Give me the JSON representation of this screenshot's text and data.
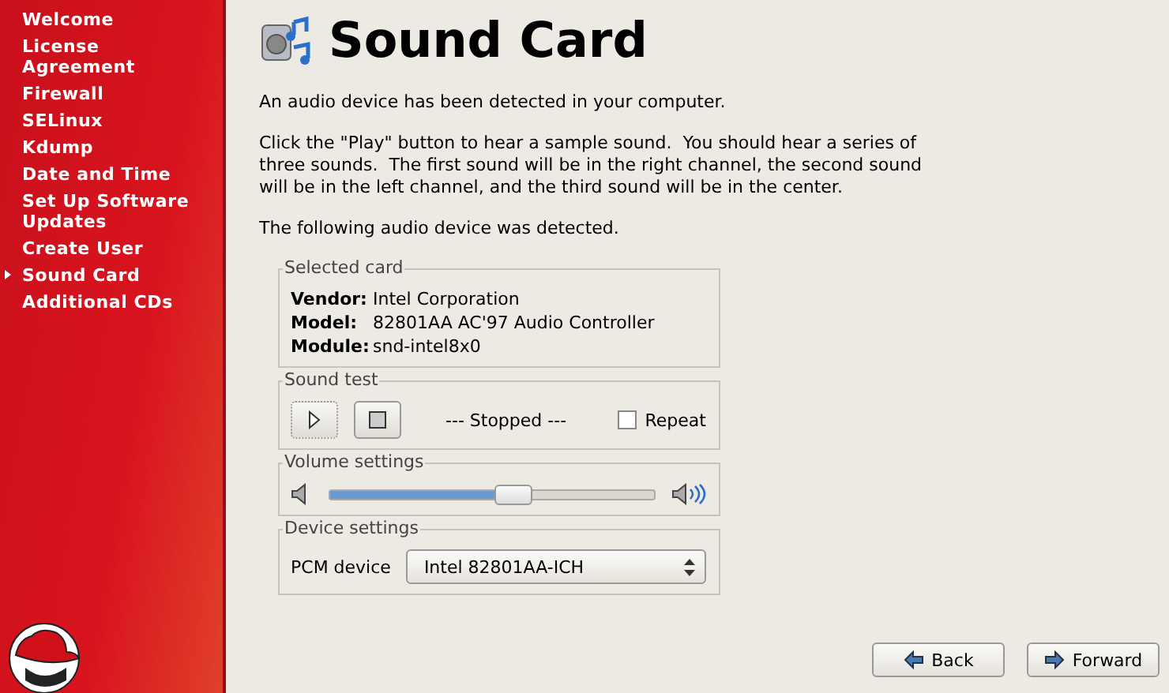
{
  "sidebar": {
    "items": [
      {
        "label": "Welcome",
        "selected": false
      },
      {
        "label": "License Agreement",
        "selected": false
      },
      {
        "label": "Firewall",
        "selected": false
      },
      {
        "label": "SELinux",
        "selected": false
      },
      {
        "label": "Kdump",
        "selected": false
      },
      {
        "label": "Date and Time",
        "selected": false
      },
      {
        "label": "Set Up Software Updates",
        "selected": false
      },
      {
        "label": "Create User",
        "selected": false
      },
      {
        "label": "Sound Card",
        "selected": true
      },
      {
        "label": "Additional CDs",
        "selected": false
      }
    ]
  },
  "page": {
    "title": "Sound Card",
    "paragraphs": [
      "An audio device has been detected in your computer.",
      "Click the \"Play\" button to hear a sample sound.  You should hear a series of three sounds.  The first sound will be in the right channel, the second sound will be in the left channel, and the third sound will be in the center.",
      "The following audio device was detected."
    ],
    "selected_card": {
      "title": "Selected card",
      "rows": [
        {
          "label": "Vendor:",
          "value": "Intel Corporation"
        },
        {
          "label": "Model:",
          "value": "82801AA AC'97 Audio Controller"
        },
        {
          "label": "Module:",
          "value": "snd-intel8x0"
        }
      ]
    },
    "sound_test": {
      "title": "Sound test",
      "status": "--- Stopped ---",
      "repeat": {
        "label": "Repeat",
        "checked": false
      }
    },
    "volume": {
      "title": "Volume settings",
      "level": 0.56
    },
    "device": {
      "title": "Device settings",
      "label": "PCM device",
      "value": "Intel 82801AA-ICH"
    }
  },
  "buttons": [
    {
      "label": "Back",
      "kind": "back"
    },
    {
      "label": "Forward",
      "kind": "forward"
    }
  ]
}
